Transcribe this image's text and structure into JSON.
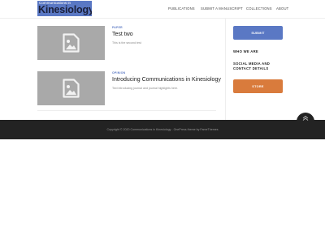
{
  "header": {
    "logo_small": "Communications in",
    "logo_big": "Kinesiology",
    "nav": [
      "PUBLICATIONS",
      "SUBMIT A MANUSCRIPT",
      "COLLECTIONS",
      "ABOUT"
    ]
  },
  "posts": [
    {
      "category": "PAPER",
      "title": "Test two",
      "excerpt": "This is the second test",
      "thumb_icon": "image-placeholder-icon"
    },
    {
      "category": "OPINION",
      "title": "Introducing Communications in Kinesiology",
      "excerpt": "Text introducing journal and journal highlights here.",
      "thumb_icon": "image-placeholder-icon"
    }
  ],
  "sidebar": {
    "submit_label": "SUBMIT",
    "who_we_are": "WHO WE ARE",
    "social_line1": "SOCIAL MEDIA AND",
    "social_line2": "CONTACT DETAILS",
    "store_label": "STORE"
  },
  "footer": {
    "text": "Copyright © 2020 Communications in Kinesiology - OnePress theme by FameThemes"
  },
  "colors": {
    "accent": "#5a78c4",
    "store": "#d97b3c",
    "footer_bg": "#232323",
    "thumb_bg": "#a9a9a9"
  },
  "icons": {
    "back_to_top": "chevron-up-icon"
  }
}
